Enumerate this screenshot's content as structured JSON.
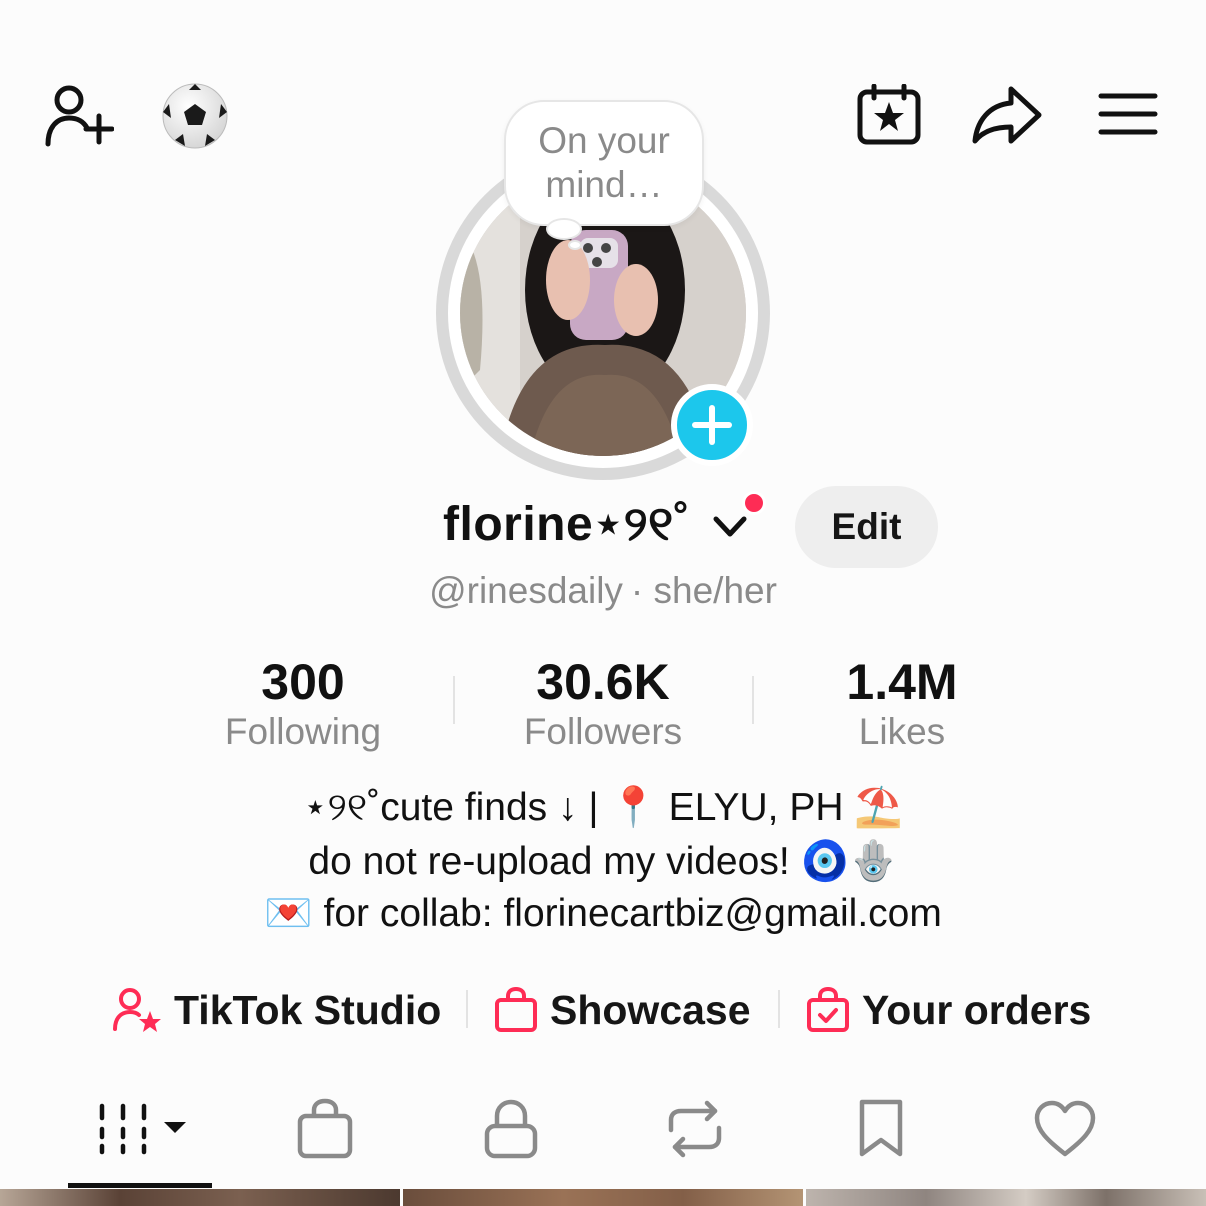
{
  "header": {
    "icons": [
      "add-friend-icon",
      "soccer-ball-icon",
      "calendar-star-icon",
      "share-icon",
      "menu-icon"
    ]
  },
  "avatar": {
    "thought_bubble": "On your mind…"
  },
  "profile": {
    "display_name": "florine⋆୨୧˚",
    "edit_label": "Edit",
    "handle": "@rinesdaily",
    "pronouns": "· she/her"
  },
  "stats": [
    {
      "value": "300",
      "label": "Following"
    },
    {
      "value": "30.6K",
      "label": "Followers"
    },
    {
      "value": "1.4M",
      "label": "Likes"
    }
  ],
  "bio": {
    "line1": "⋆୨୧˚cute finds ↓ | 📍 ELYU, PH ⛱️",
    "line2": "do not re-upload my videos! 🧿🪬",
    "line3": "💌  for collab: florinecartbiz@gmail.com"
  },
  "quick_links": [
    {
      "label": "TikTok Studio",
      "icon": "creator-star-icon"
    },
    {
      "label": "Showcase",
      "icon": "shopping-bag-icon"
    },
    {
      "label": "Your orders",
      "icon": "order-bag-check-icon"
    }
  ],
  "tabs": [
    "videos-grid-icon",
    "shop-bag-icon",
    "private-lock-icon",
    "repost-icon",
    "saved-bookmark-icon",
    "liked-heart-icon"
  ],
  "colors": {
    "accent_red": "#fe2c55",
    "add_button": "#1cc7ec",
    "secondary_text": "#8a8a8a"
  }
}
